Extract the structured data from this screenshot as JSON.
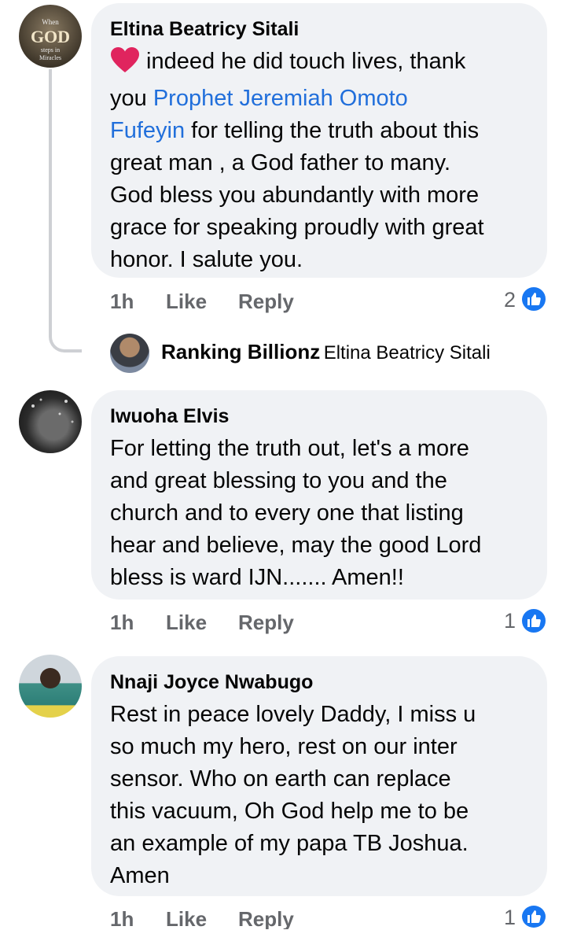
{
  "comments": [
    {
      "author": "Eltina Beatricy Sitali",
      "avatar_text": {
        "line1": "When",
        "line2": "GOD",
        "line3": "steps in",
        "line4": "Miracles"
      },
      "emoji": "red-heart",
      "text_parts": [
        " indeed he did touch lives, thank",
        "you ",
        "Prophet Jeremiah Omoto",
        "Fufeyin",
        " for telling the truth about this",
        "great man , a God father to many.",
        "God bless you abundantly with more",
        "grace for speaking proudly with great",
        "honor.  I salute you."
      ],
      "time": "1h",
      "like_label": "Like",
      "reply_label": "Reply",
      "reaction_count": "2"
    },
    {
      "author": "Iwuoha Elvis",
      "lines": [
        "For letting the truth out, let's a more",
        "and great blessing to you and the",
        "church and to every one that listing",
        "hear and believe, may the good Lord",
        "bless is ward IJN....... Amen!!"
      ],
      "time": "1h",
      "like_label": "Like",
      "reply_label": "Reply",
      "reaction_count": "1"
    },
    {
      "author": "Nnaji Joyce Nwabugo",
      "lines": [
        "Rest in peace lovely Daddy, I miss u",
        "so much my hero, rest on our inter",
        "sensor. Who on earth can replace",
        "this vacuum, Oh God  help me to be",
        "an example of my papa TB Joshua.",
        "Amen"
      ],
      "time": "1h",
      "like_label": "Like",
      "reply_label": "Reply",
      "reaction_count": "1"
    }
  ],
  "reply_preview": {
    "author": "Ranking Billionz",
    "replying_to": "Eltina Beatricy Sitali"
  },
  "colors": {
    "bubble": "#f0f2f5",
    "mention": "#216fdb",
    "meta": "#65676b",
    "like_blue": "#1877f2",
    "heart": "#e0245e"
  },
  "icons": [
    "heart-emoji-icon",
    "thumbs-up-icon"
  ]
}
